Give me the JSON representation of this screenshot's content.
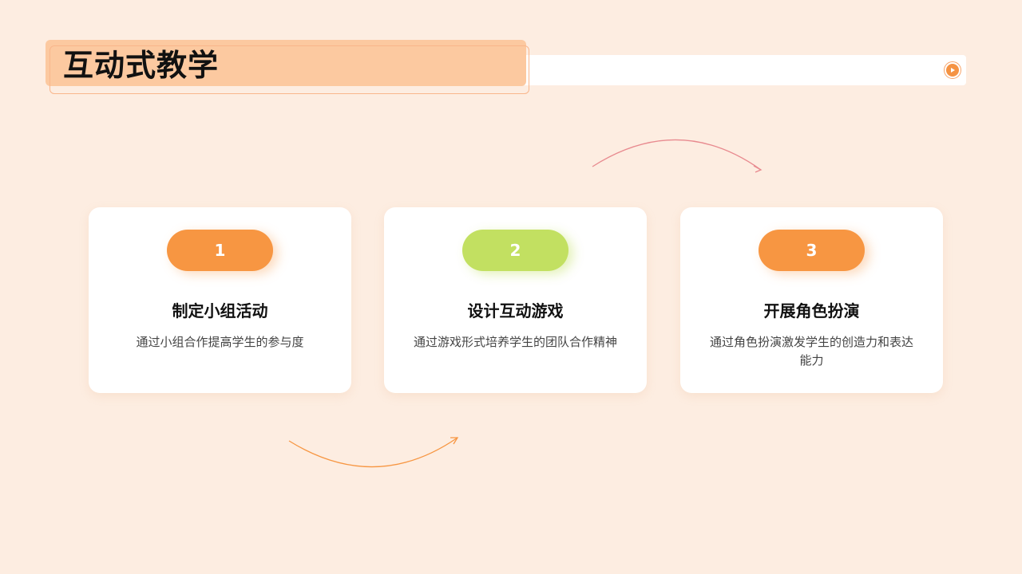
{
  "header": {
    "title": "互动式教学"
  },
  "colors": {
    "background": "#fdede1",
    "title_block": "#fcc9a0",
    "accent_orange": "#f79642",
    "accent_green": "#c2e061",
    "arrow_top": "#e88a8f",
    "arrow_bottom": "#f79642"
  },
  "cards": [
    {
      "number": "1",
      "title": "制定小组活动",
      "description": "通过小组合作提高学生的参与度"
    },
    {
      "number": "2",
      "title": "设计互动游戏",
      "description": "通过游戏形式培养学生的团队合作精神"
    },
    {
      "number": "3",
      "title": "开展角色扮演",
      "description": "通过角色扮演激发学生的创造力和表达能力"
    }
  ],
  "icons": {
    "play": "play-icon"
  }
}
